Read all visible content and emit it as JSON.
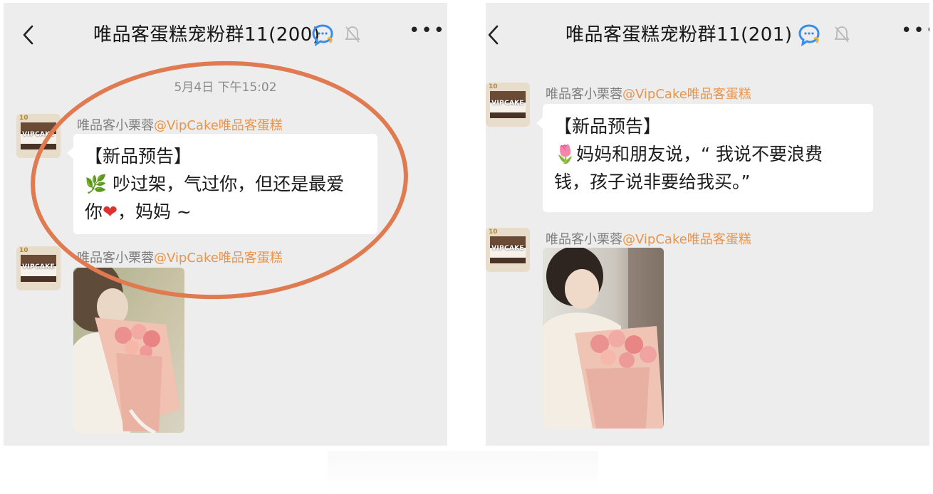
{
  "screens": [
    {
      "title": "唯品客蛋糕宠粉群11(200)",
      "timestamp": "5月4日 下午15:02",
      "messages": [
        {
          "sender_name": "唯品客小栗蓉",
          "sender_tag": "@VipCake唯品客蛋糕",
          "line1": "【新品预告】",
          "line2_emoji": "🌿",
          "line2": "吵过架，气过你，但还是最爱",
          "line3_a": "你",
          "line3_heart": "❤",
          "line3_b": "，妈妈 ~"
        },
        {
          "sender_name": "唯品客小栗蓉",
          "sender_tag": "@VipCake唯品客蛋糕"
        }
      ]
    },
    {
      "title": "唯品客蛋糕宠粉群11(201)",
      "messages": [
        {
          "sender_name": "唯品客小栗蓉",
          "sender_tag": "@VipCake唯品客蛋糕",
          "line1": "【新品预告】",
          "line2_emoji": "🌷",
          "line2": "妈妈和朋友说，“ 我说不要浪费",
          "line3": "钱，孩子说非要给我买。”"
        },
        {
          "sender_name": "唯品客小栗蓉",
          "sender_tag": "@VipCake唯品客蛋糕"
        }
      ]
    }
  ],
  "avatar": {
    "number": "10",
    "brand": "VIPCAKE"
  },
  "icons": {
    "back": "chevron-left-icon",
    "group": "chat-bubble-icon",
    "mute": "muted-bell-icon",
    "more": "more-dots-icon"
  },
  "colors": {
    "background": "#ededed",
    "tag": "#e8944a",
    "annotation": "#e07a50"
  }
}
